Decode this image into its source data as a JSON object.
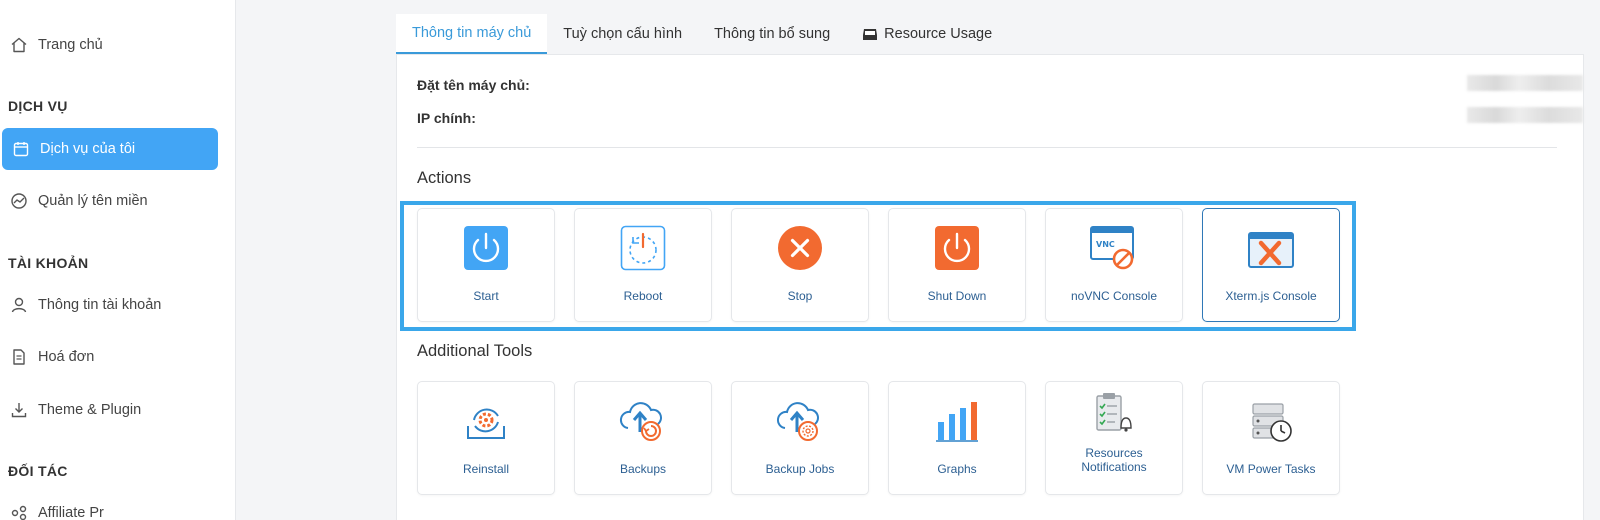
{
  "sidebar": {
    "home": "Trang chủ",
    "section_services": "DỊCH VỤ",
    "my_services": "Dịch vụ của tôi",
    "domains": "Quản lý tên miền",
    "section_account": "TÀI KHOẢN",
    "account_info": "Thông tin tài khoản",
    "invoices": "Hoá đơn",
    "theme_plugin": "Theme & Plugin",
    "section_partner": "ĐỐI TÁC",
    "affiliate": "Affiliate Pr"
  },
  "tabs": [
    {
      "label": "Thông tin máy chủ",
      "active": true
    },
    {
      "label": "Tuỳ chọn cấu hình",
      "active": false
    },
    {
      "label": "Thông tin bổ sung",
      "active": false
    },
    {
      "label": "Resource Usage",
      "active": false
    }
  ],
  "server": {
    "name_label": "Đặt tên máy chủ:",
    "ip_label": "IP chính:"
  },
  "actions": {
    "heading": "Actions",
    "items": [
      {
        "label": "Start",
        "icon": "start-power-icon"
      },
      {
        "label": "Reboot",
        "icon": "reboot-icon"
      },
      {
        "label": "Stop",
        "icon": "stop-icon"
      },
      {
        "label": "Shut Down",
        "icon": "shutdown-icon"
      },
      {
        "label": "noVNC Console",
        "icon": "novnc-console-icon"
      },
      {
        "label": "Xterm.js Console",
        "icon": "xterm-console-icon"
      }
    ]
  },
  "tools": {
    "heading": "Additional Tools",
    "items": [
      {
        "label": "Reinstall",
        "icon": "reinstall-icon"
      },
      {
        "label": "Backups",
        "icon": "backups-icon"
      },
      {
        "label": "Backup Jobs",
        "icon": "backup-jobs-icon"
      },
      {
        "label": "Graphs",
        "icon": "graphs-icon"
      },
      {
        "label": "Resources Notifications",
        "label_line1": "Resources",
        "label_line2": "Notifications",
        "icon": "resources-notifications-icon"
      },
      {
        "label": "VM Power Tasks",
        "icon": "vm-power-tasks-icon"
      }
    ]
  },
  "colors": {
    "accent": "#42a5f5",
    "tab_active": "#3a9ad9",
    "highlight_border": "#3aa7ea",
    "orange": "#f26a30"
  }
}
